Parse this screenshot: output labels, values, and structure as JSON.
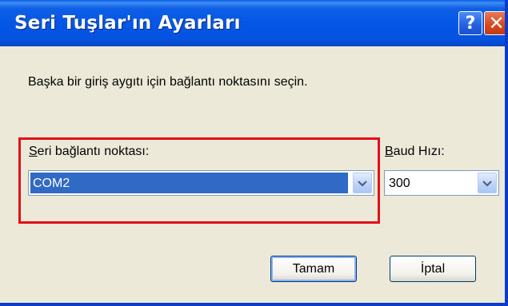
{
  "window": {
    "title": "Seri Tuşlar'ın Ayarları",
    "help_label": "?",
    "close_label": "✕"
  },
  "instruction": "Başka bir giriş aygıtı için bağlantı noktasını seçin.",
  "port": {
    "label_first": "S",
    "label_rest": "eri bağlantı noktası:",
    "selected": "COM2"
  },
  "baud": {
    "label_first": "B",
    "label_rest": "aud Hızı:",
    "selected": "300"
  },
  "buttons": {
    "ok": "Tamam",
    "cancel": "İptal"
  },
  "colors": {
    "highlight": "#e3101a",
    "selection": "#316ac5",
    "titlebar": "#0456e5"
  },
  "icons": {
    "help": "question-mark-icon",
    "close": "close-icon",
    "dropdown": "chevron-down-icon"
  }
}
